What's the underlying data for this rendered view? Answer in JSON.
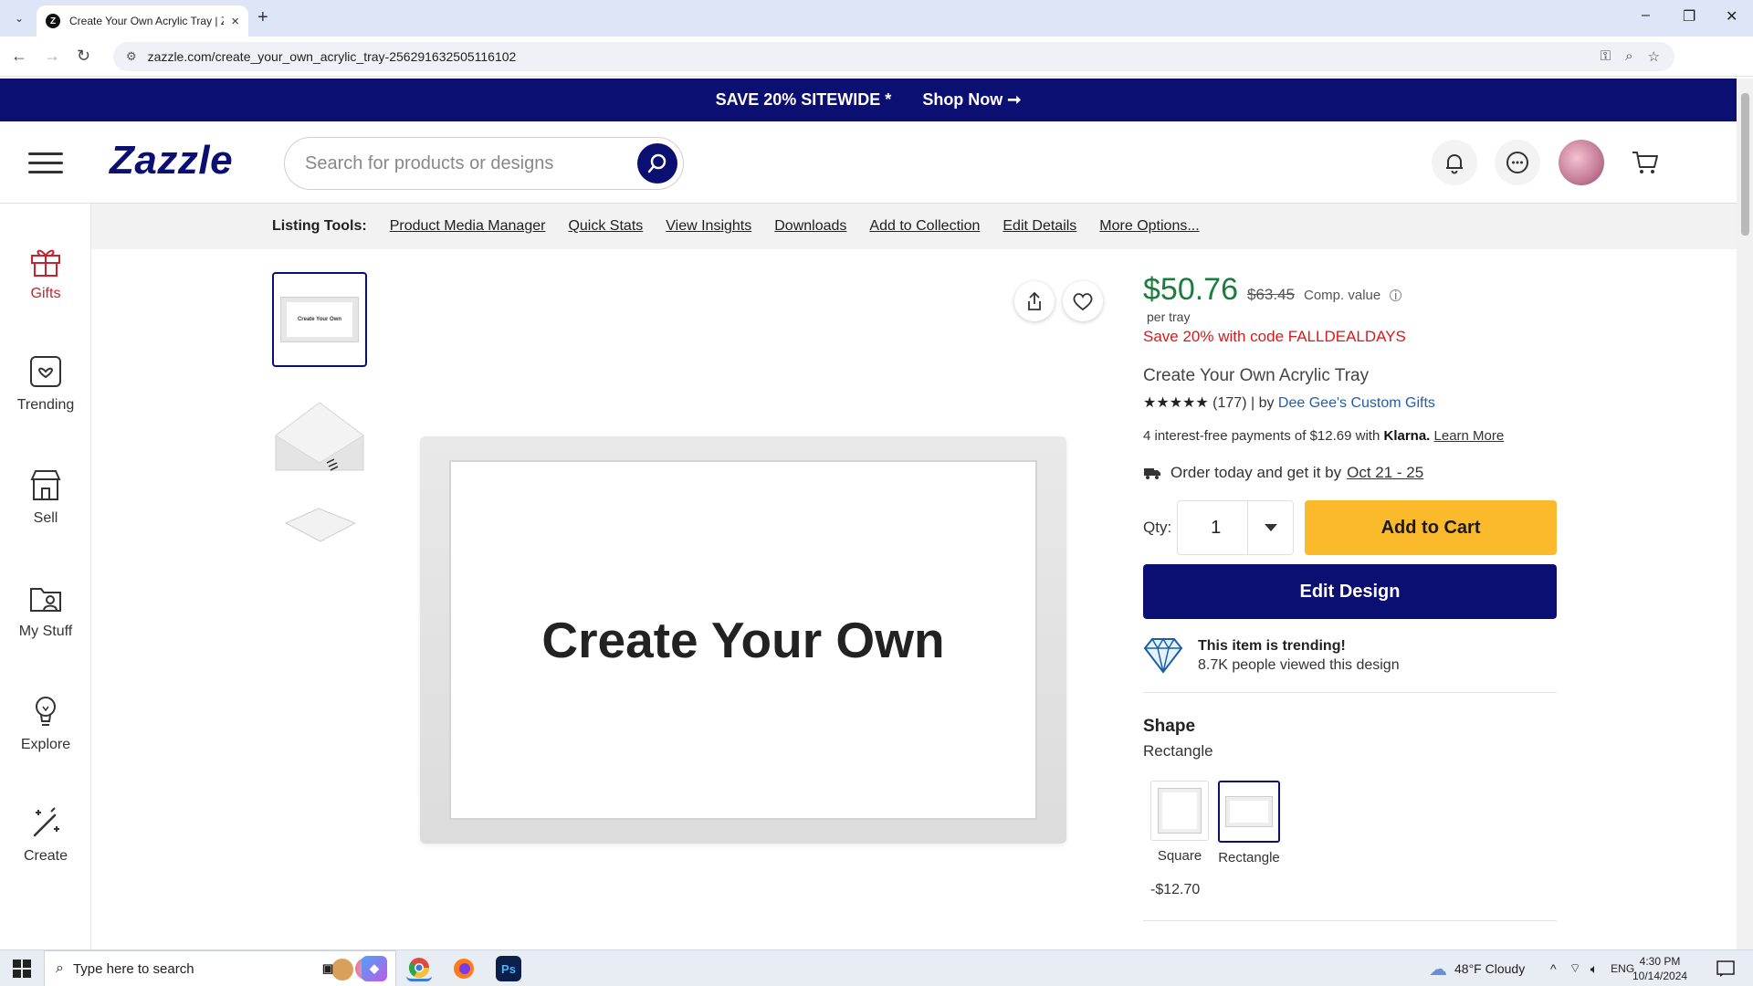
{
  "browser": {
    "tab_title": "Create Your Own Acrylic Tray | Z",
    "url": "zazzle.com/create_your_own_acrylic_tray-256291632505116102"
  },
  "promo": {
    "text": "SAVE 20% SITEWIDE *",
    "link": "Shop Now ➞"
  },
  "header": {
    "logo": "Zazzle",
    "search_placeholder": "Search for products or designs"
  },
  "rail": [
    {
      "label": "Gifts",
      "icon": "gift-icon"
    },
    {
      "label": "Trending",
      "icon": "trending-icon"
    },
    {
      "label": "Sell",
      "icon": "store-icon"
    },
    {
      "label": "My Stuff",
      "icon": "folder-icon"
    },
    {
      "label": "Explore",
      "icon": "lightbulb-icon"
    },
    {
      "label": "Create",
      "icon": "magic-wand-icon"
    }
  ],
  "listing_tools": {
    "label": "Listing Tools:",
    "links": [
      "Product Media Manager",
      "Quick Stats",
      "View Insights",
      "Downloads",
      "Add to Collection",
      "Edit Details",
      "More Options..."
    ]
  },
  "gallery": {
    "main_text": "Create Your Own",
    "thumb_text": "Create Your Own"
  },
  "product": {
    "price": "$50.76",
    "comp_price": "$63.45",
    "comp_label": "Comp. value",
    "per": "per tray",
    "save_code": "Save 20% with code FALLDEALDAYS",
    "title": "Create Your Own Acrylic Tray",
    "stars": "★★★★★",
    "reviews": "(177) | by",
    "seller": "Dee Gee's Custom Gifts",
    "klarna_text": "4 interest-free payments of $12.69 with",
    "klarna_brand": "Klarna.",
    "klarna_link": "Learn More",
    "delivery_text": "Order today and get it by",
    "delivery_date": "Oct 21 - 25",
    "qty_label": "Qty:",
    "qty_value": "1",
    "add_to_cart": "Add to Cart",
    "edit_design": "Edit Design",
    "trending_title": "This item is trending!",
    "trending_sub": "8.7K people viewed this design",
    "shape_title": "Shape",
    "shape_value": "Rectangle",
    "shape_options": [
      "Square",
      "Rectangle"
    ],
    "shape_price": "-$12.70"
  },
  "taskbar": {
    "search_placeholder": "Type here to search",
    "weather": "48°F  Cloudy",
    "lang": "ENG",
    "time": "4:30 PM",
    "date": "10/14/2024"
  },
  "colors": {
    "brand_navy": "#0b0f72",
    "price_green": "#1a7d3c",
    "promo_red": "#d61a1a",
    "cart_yellow": "#fbba2c"
  }
}
